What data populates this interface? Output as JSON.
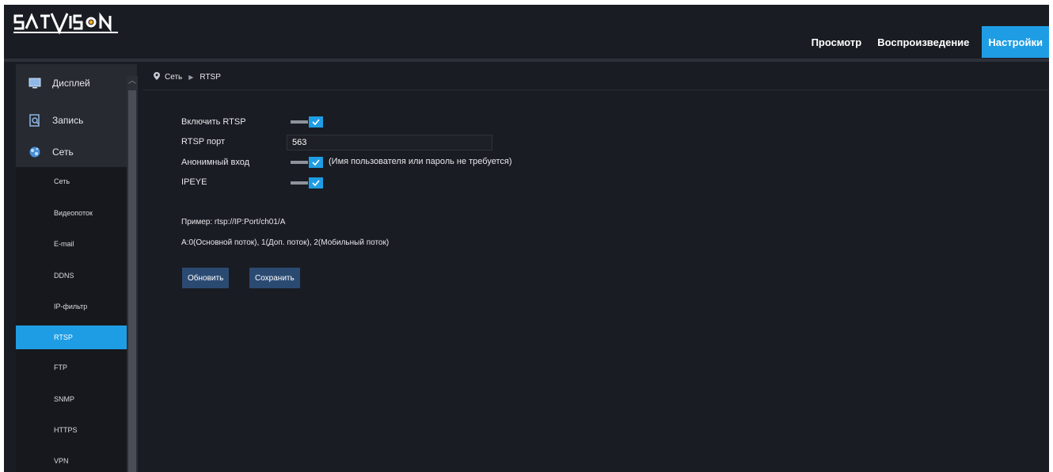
{
  "header": {
    "logo_text": "SATVISION",
    "nav": [
      {
        "label": "Просмотр"
      },
      {
        "label": "Воспроизведение"
      },
      {
        "label": "Настройки"
      }
    ]
  },
  "sidebar": {
    "main_items": [
      {
        "label": "Дисплей"
      },
      {
        "label": "Запись"
      },
      {
        "label": "Сеть"
      }
    ],
    "sub_items": [
      {
        "label": "Сеть"
      },
      {
        "label": "Видеопоток"
      },
      {
        "label": "E-mail"
      },
      {
        "label": "DDNS"
      },
      {
        "label": "IP-фильтр"
      },
      {
        "label": "RTSP"
      },
      {
        "label": "FTP"
      },
      {
        "label": "SNMP"
      },
      {
        "label": "HTTPS"
      },
      {
        "label": "VPN"
      }
    ]
  },
  "breadcrumb": {
    "section": "Сеть",
    "page": "RTSP"
  },
  "form": {
    "enable_rtsp_label": "Включить RTSP",
    "rtsp_port_label": "RTSP порт",
    "rtsp_port_value": "563",
    "anonymous_label": "Анонимный вход",
    "anonymous_note": "(Имя пользователя или пароль не требуется)",
    "ipeye_label": "IPEYE",
    "example": "Пример: rtsp://IP:Port/ch01/A",
    "streams": "A:0(Основной поток), 1(Доп. поток), 2(Мобильный поток)",
    "refresh_button": "Обновить",
    "save_button": "Сохранить"
  },
  "colors": {
    "accent": "#1f9de4",
    "background": "#1a1c23",
    "button": "#2b4a72"
  }
}
